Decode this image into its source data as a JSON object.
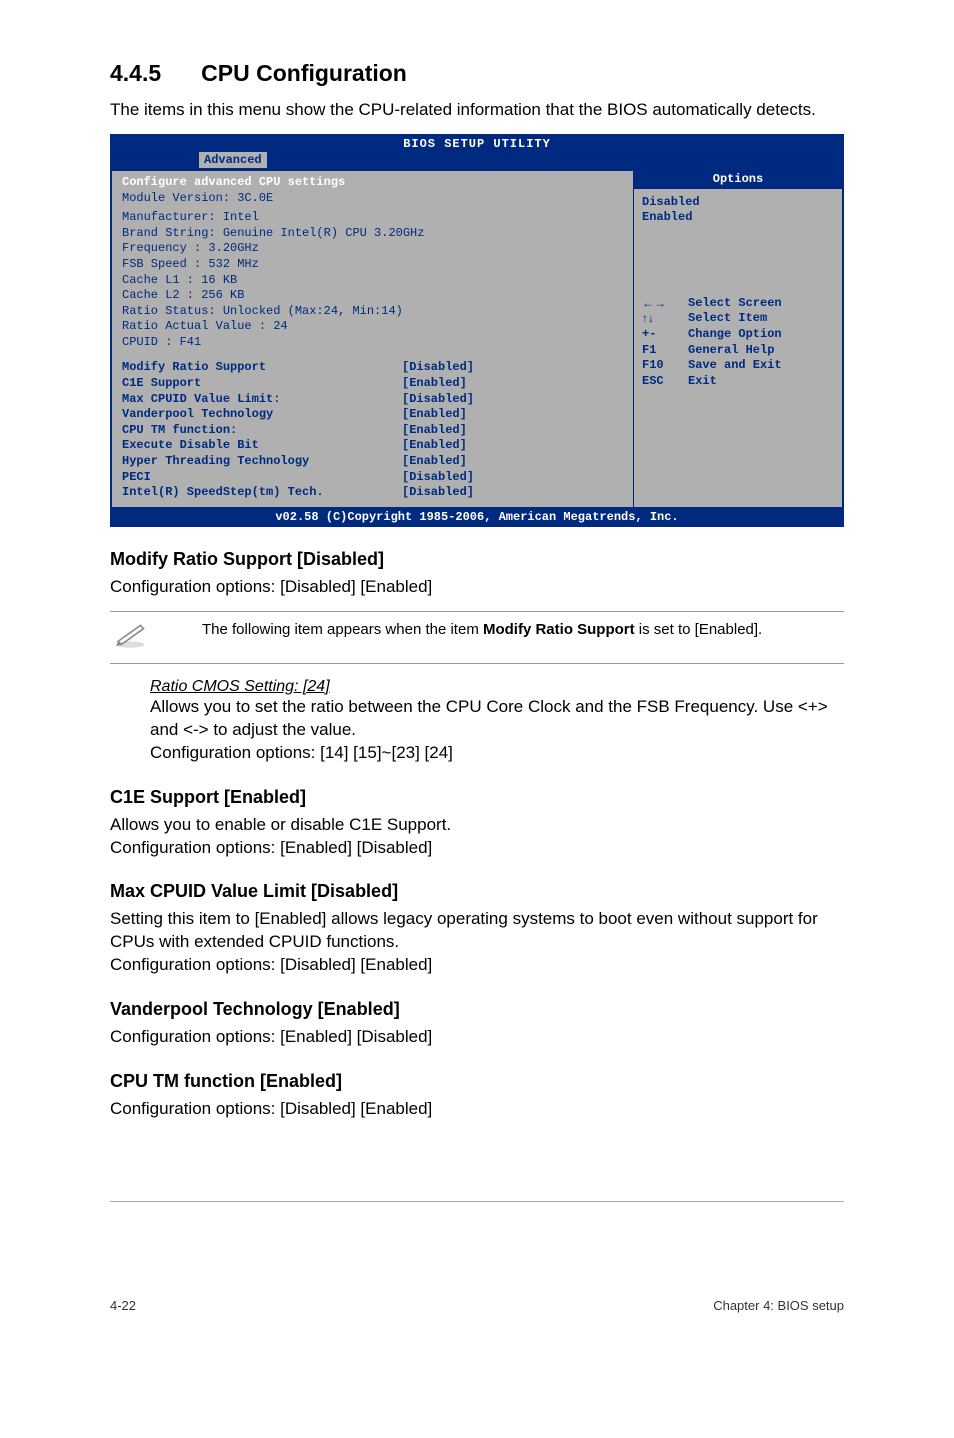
{
  "section": {
    "num": "4.4.5",
    "title": "CPU Configuration"
  },
  "intro": "The items in this menu show the CPU-related information that the BIOS automatically detects.",
  "bios": {
    "title": "BIOS SETUP UTILITY",
    "tab": "Advanced",
    "left_header1": "Configure advanced CPU settings",
    "left_header2": "Module Version: 3C.0E",
    "info": [
      "Manufacturer: Intel",
      "Brand String: Genuine Intel(R) CPU 3.20GHz",
      "Frequency   : 3.20GHz",
      "FSB Speed   : 532 MHz",
      "Cache L1    : 16 KB",
      "Cache L2    : 256 KB",
      "Ratio Status: Unlocked (Max:24, Min:14)",
      "Ratio Actual Value : 24",
      "CPUID       : F41"
    ],
    "settings": [
      {
        "label": "Modify Ratio Support",
        "value": "[Disabled]"
      },
      {
        "label": "C1E Support",
        "value": "[Enabled]"
      },
      {
        "label": "Max CPUID Value Limit:",
        "value": "[Disabled]"
      },
      {
        "label": "Vanderpool Technology",
        "value": "[Enabled]"
      },
      {
        "label": "CPU TM function:",
        "value": "[Enabled]"
      },
      {
        "label": "Execute Disable Bit",
        "value": "[Enabled]"
      },
      {
        "label": "Hyper Threading Technology",
        "value": "[Enabled]"
      },
      {
        "label": "PECI",
        "value": "[Disabled]"
      },
      {
        "label": "Intel(R) SpeedStep(tm) Tech.",
        "value": "[Disabled]"
      }
    ],
    "right": {
      "options_hdr": "Options",
      "opt1": "Disabled",
      "opt2": "Enabled",
      "nav": [
        {
          "key": "←→",
          "label": "Select Screen"
        },
        {
          "key": "↑↓",
          "label": "Select Item"
        },
        {
          "key": "+-",
          "label": "Change Option"
        },
        {
          "key": "F1",
          "label": "General Help"
        },
        {
          "key": "F10",
          "label": "Save and Exit"
        },
        {
          "key": "ESC",
          "label": "Exit"
        }
      ]
    },
    "footer": "v02.58 (C)Copyright 1985-2006, American Megatrends, Inc."
  },
  "sec1": {
    "heading": "Modify Ratio Support [Disabled]",
    "text": "Configuration options: [Disabled] [Enabled]",
    "note_pre": "The following item appears when the item ",
    "note_bold": "Modify Ratio Support",
    "note_post": " is set to [Enabled].",
    "sub_heading": "Ratio CMOS Setting: [24]",
    "sub_text1": "Allows you to set the ratio between the CPU Core Clock and the FSB Frequency. Use <+> and <-> to adjust the value.",
    "sub_text2": "Configuration options: [14] [15]~[23] [24]"
  },
  "sec2": {
    "heading": "C1E Support [Enabled]",
    "text1": "Allows you to enable or disable C1E Support.",
    "text2": "Configuration options: [Enabled] [Disabled]"
  },
  "sec3": {
    "heading": "Max CPUID Value Limit [Disabled]",
    "text1": "Setting this item to [Enabled] allows legacy operating systems to boot even without support for CPUs with extended CPUID functions.",
    "text2": "Configuration options: [Disabled] [Enabled]"
  },
  "sec4": {
    "heading": "Vanderpool Technology [Enabled]",
    "text": "Configuration options: [Enabled] [Disabled]"
  },
  "sec5": {
    "heading": "CPU TM function [Enabled]",
    "text": "Configuration options: [Disabled] [Enabled]"
  },
  "footer": {
    "left": "4-22",
    "right": "Chapter 4: BIOS setup"
  }
}
